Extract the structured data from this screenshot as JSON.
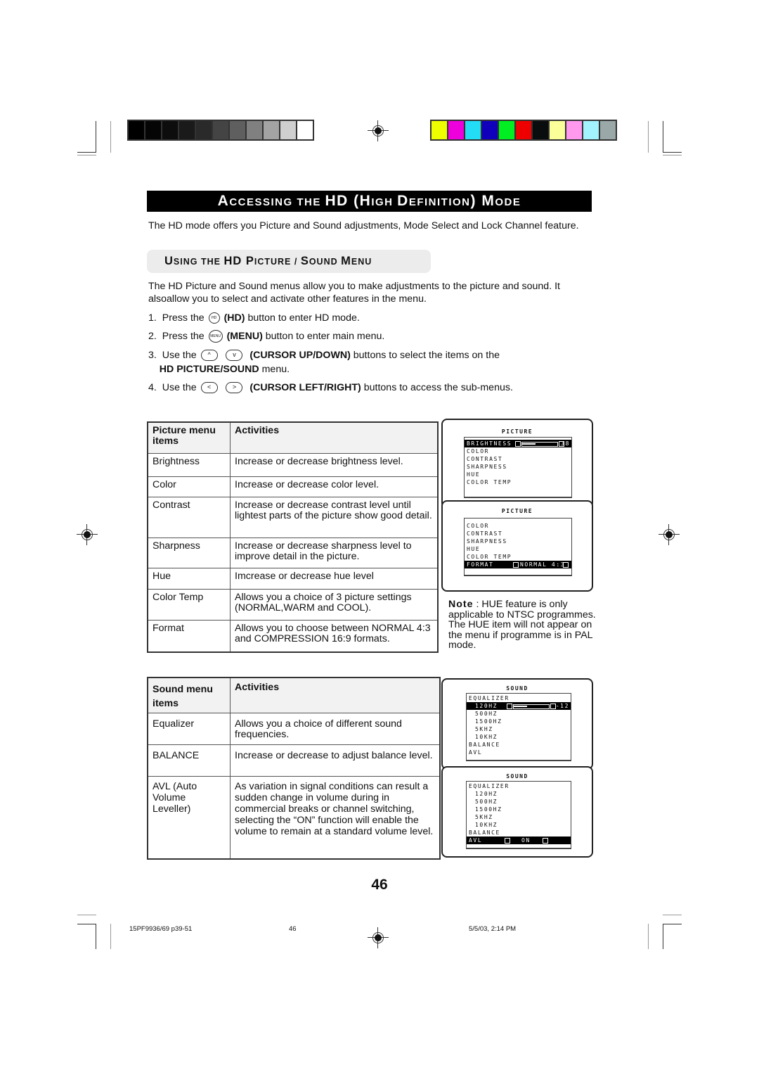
{
  "color_bars": {
    "grayscale": [
      "#000000",
      "#050505",
      "#0d0d0d",
      "#1a1a1a",
      "#2a2a2a",
      "#444444",
      "#5f5f5f",
      "#808080",
      "#a3a3a3",
      "#cfcfcf",
      "#ffffff"
    ],
    "colors": [
      "#eeff00",
      "#ee00dd",
      "#22ddf5",
      "#1100bb",
      "#00ee22",
      "#ee0000",
      "#0a0d0d",
      "#faff99",
      "#ff99ee",
      "#a3f3ff",
      "#9aa8a8"
    ]
  },
  "header": {
    "title_parts": [
      "A",
      "CCESSING THE ",
      "HD (H",
      "IGH ",
      "D",
      "EFINITION",
      "",
      ") M",
      "ODE"
    ],
    "title": "Accessing the HD (High Definition) Mode"
  },
  "intro": "The HD mode offers you Picture and Sound adjustments,  Mode Select and Lock Channel feature.",
  "section": {
    "title": "Using the HD Picture / Sound Menu",
    "parts": [
      "U",
      "SING THE ",
      "HD P",
      "ICTURE / ",
      "S",
      "OUND ",
      "M",
      "ENU"
    ]
  },
  "description": " The HD Picture and Sound menus allow you to make adjustments to the picture and sound. It alsoallow you to select and activate other features in the menu.",
  "steps": [
    {
      "num": "1.",
      "pre": "Press the",
      "icons": [
        "HD"
      ],
      "bold": "(HD)",
      "post": "button to enter HD mode."
    },
    {
      "num": "2.",
      "pre": "Press the",
      "icons": [
        "MENU"
      ],
      "bold": "(MENU)",
      "post": "button to enter main menu."
    },
    {
      "num": "3.",
      "pre": "Use the",
      "icons": [
        "^",
        "v"
      ],
      "bold": "(CURSOR UP/DOWN)",
      "post": " buttons to select the items on the",
      "line2_bold": "HD PICTURE/SOUND",
      "line2": " menu."
    },
    {
      "num": "4.",
      "pre": "Use the",
      "icons": [
        "<",
        ">"
      ],
      "bold": "(CURSOR LEFT/RIGHT)",
      "post": " buttons to access the sub-menus."
    }
  ],
  "picture_table": {
    "headers": [
      "Picture menu items",
      "Activities"
    ],
    "rows": [
      {
        "item": "Brightness",
        "activity": "Increase or decrease brightness level."
      },
      {
        "item": "Color",
        "activity": "Increase or decrease color level."
      },
      {
        "item": "Contrast",
        "activity": "Increase or decrease contrast level   until lightest parts of the picture show good detail."
      },
      {
        "item": "Sharpness",
        "activity": "Increase or decrease sharpness level to improve detail in the picture."
      },
      {
        "item": "Hue",
        "activity": "Imcrease or decrease hue level"
      },
      {
        "item": "Color Temp",
        "activity": "Allows you a choice of 3 picture settings (NORMAL,WARM and COOL)."
      },
      {
        "item": "Format",
        "activity": "Allows you to choose between NORMAL 4:3 and COMPRESSION 16:9 formats."
      }
    ]
  },
  "sound_table": {
    "headers": [
      "Sound menu items",
      "Activities"
    ],
    "rows": [
      {
        "item": "Equalizer",
        "activity": "Allows you a choice of different sound frequencies."
      },
      {
        "item": "BALANCE",
        "activity": "Increase or decrease to adjust balance level."
      },
      {
        "item": "AVL (Auto Volume Leveller)",
        "activity": "As variation in signal conditions can result a sudden change in volume during in commercial breaks or channel switching, selecting the “ON” function will enable the volume to remain at a standard volume level."
      }
    ]
  },
  "osd_picture_1": {
    "title": "PICTURE",
    "items": [
      "BRIGHTNESS",
      "COLOR",
      "CONTRAST",
      "SHARPNESS",
      "HUE",
      "COLOR TEMP"
    ],
    "selected": "BRIGHTNESS",
    "value": "38",
    "slider_fraction": 0.38
  },
  "osd_picture_2": {
    "title": "PICTURE",
    "items": [
      "COLOR",
      "CONTRAST",
      "SHARPNESS",
      "HUE",
      "COLOR TEMP",
      "FORMAT"
    ],
    "selected": "FORMAT",
    "value": "NORMAL 4:3"
  },
  "osd_sound_1": {
    "title": "SOUND",
    "items": [
      "EQUALIZER",
      "120HZ",
      "500HZ",
      "1500HZ",
      "5KHZ",
      "10KHZ",
      "BALANCE",
      "AVL"
    ],
    "selected": "120HZ",
    "value": "-12",
    "slider_fraction": 0.38
  },
  "osd_sound_2": {
    "title": "SOUND",
    "items": [
      "EQUALIZER",
      "120HZ",
      "500HZ",
      "1500HZ",
      "5KHZ",
      "10KHZ",
      "BALANCE",
      "AVL"
    ],
    "selected": "AVL",
    "value": "ON"
  },
  "note": {
    "label": "Note",
    "text": " : HUE feature is only applicable to NTSC programmes. The HUE item will not appear on the menu if programme is in PAL mode."
  },
  "page_number": "46",
  "footer": {
    "file": "15PF9936/69 p39-51",
    "page": "46",
    "date": "5/5/03, 2:14 PM"
  }
}
